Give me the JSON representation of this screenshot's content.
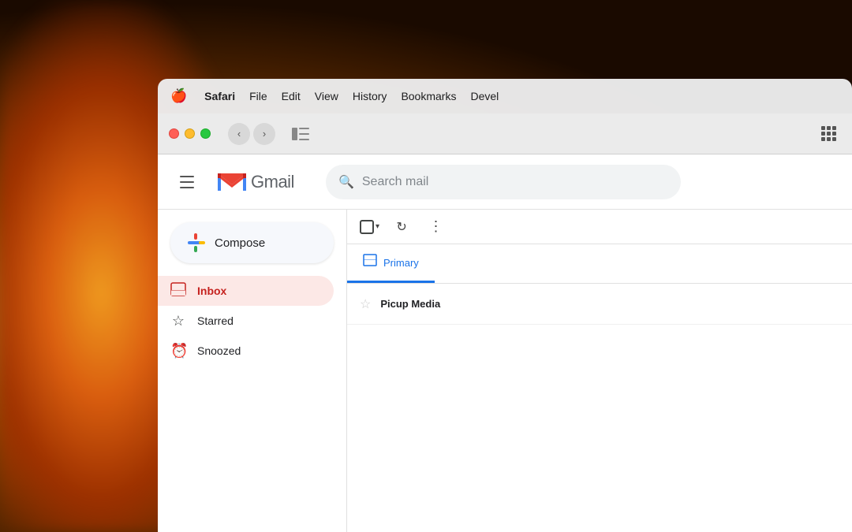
{
  "background": {
    "color_left": "#c87020",
    "color_dark": "#1a0a00"
  },
  "menubar": {
    "apple": "🍎",
    "items": [
      {
        "label": "Safari",
        "bold": true
      },
      {
        "label": "File"
      },
      {
        "label": "Edit"
      },
      {
        "label": "View"
      },
      {
        "label": "History"
      },
      {
        "label": "Bookmarks"
      },
      {
        "label": "Devel"
      }
    ]
  },
  "browser": {
    "back_arrow": "‹",
    "forward_arrow": "›"
  },
  "gmail": {
    "logo_m": "M",
    "logo_text": "Gmail",
    "search_placeholder": "Search mail",
    "compose_label": "Compose",
    "nav_items": [
      {
        "label": "Inbox",
        "icon": "📥",
        "active": true
      },
      {
        "label": "Starred",
        "icon": "☆",
        "active": false
      },
      {
        "label": "Snoozed",
        "icon": "⏰",
        "active": false
      }
    ],
    "toolbar": {
      "more_dots": "⋮"
    },
    "tabs": [
      {
        "label": "Primary",
        "icon": "□",
        "active": true
      }
    ],
    "email_rows": [
      {
        "sender": "Picup Media",
        "subject": "",
        "starred": false
      }
    ]
  }
}
